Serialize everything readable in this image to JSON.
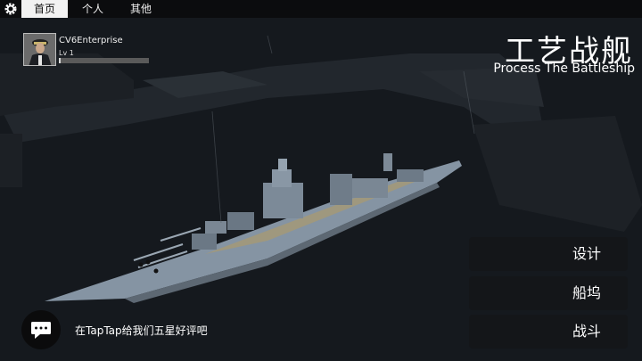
{
  "nav": {
    "tabs": [
      {
        "label": "首页",
        "active": true
      },
      {
        "label": "个人",
        "active": false
      },
      {
        "label": "其他",
        "active": false
      }
    ]
  },
  "player": {
    "name": "CV6Enterprise",
    "level": "Lv 1",
    "xp_fraction": 0.02
  },
  "title": {
    "cn": "工艺战舰",
    "en": "Process The Battleship"
  },
  "menu": {
    "design": "设计",
    "dock": "船坞",
    "battle": "战斗"
  },
  "chat": {
    "message": "在TapTap给我们五星好评吧"
  },
  "colors": {
    "sea": "#15191e",
    "hull": "#8a99a8",
    "deck": "#b3a37a",
    "topbar": "#0b0c0e"
  }
}
